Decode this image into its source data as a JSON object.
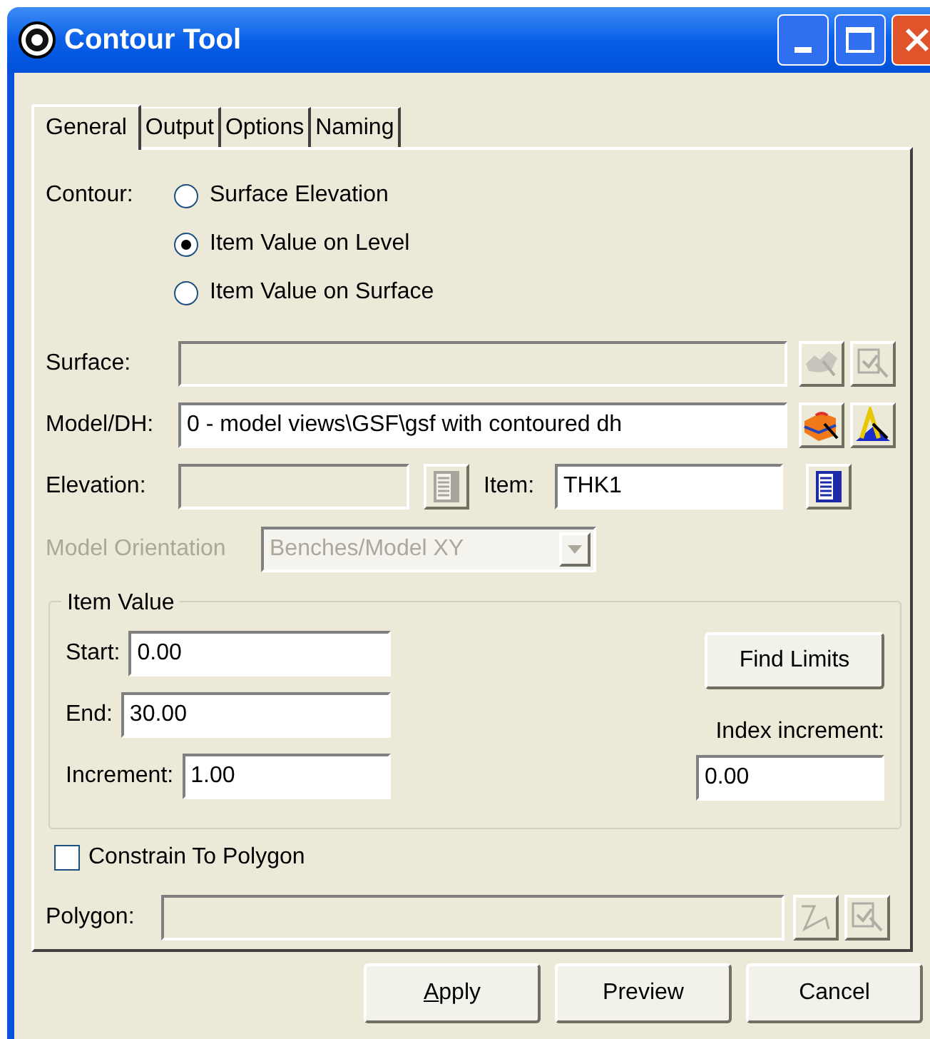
{
  "window": {
    "title": "Contour Tool"
  },
  "tabs": [
    {
      "label": "General",
      "selected": true
    },
    {
      "label": "Output",
      "selected": false
    },
    {
      "label": "Options",
      "selected": false
    },
    {
      "label": "Naming",
      "selected": false
    }
  ],
  "contour": {
    "label": "Contour:",
    "options": [
      {
        "label": "Surface Elevation",
        "selected": false
      },
      {
        "label": "Item Value on Level",
        "selected": true
      },
      {
        "label": "Item Value on Surface",
        "selected": false
      }
    ]
  },
  "surface": {
    "label": "Surface:",
    "disabled": true,
    "buttons": [
      {
        "kind": "surface",
        "disabled": true
      },
      {
        "kind": "select",
        "disabled": true
      }
    ]
  },
  "model": {
    "label": "Model/DH:",
    "value": "0 - model views\\GSF\\gsf with contoured dh",
    "disabled": false,
    "buttons": [
      {
        "kind": "model",
        "disabled": false
      },
      {
        "kind": "drillhole",
        "disabled": false
      }
    ]
  },
  "elevation": {
    "label": "Elevation:",
    "disabled": true,
    "button_disabled": true
  },
  "item": {
    "label": "Item:",
    "value": "THK1",
    "button_disabled": false
  },
  "model_orientation": {
    "label": "Model Orientation",
    "value": "Benches/Model XY",
    "disabled": true
  },
  "item_value": {
    "title": "Item Value",
    "rows": [
      {
        "label": "Start:",
        "value": "0.00"
      },
      {
        "label": "End:",
        "value": "30.00"
      },
      {
        "label": "Increment:",
        "value": "1.00"
      }
    ],
    "find_limits": "Find Limits",
    "index_increment": {
      "label": "Index increment:",
      "value": "0.00"
    }
  },
  "constrain": {
    "label": "Constrain To Polygon",
    "checked": false
  },
  "polygon": {
    "label": "Polygon:",
    "disabled": true,
    "buttons": [
      {
        "kind": "polygon",
        "disabled": true
      },
      {
        "kind": "select",
        "disabled": true
      }
    ]
  },
  "buttons": [
    {
      "label": "Apply",
      "mnemonic": true
    },
    {
      "label": "Preview",
      "mnemonic": false
    },
    {
      "label": "Cancel",
      "mnemonic": false
    }
  ]
}
